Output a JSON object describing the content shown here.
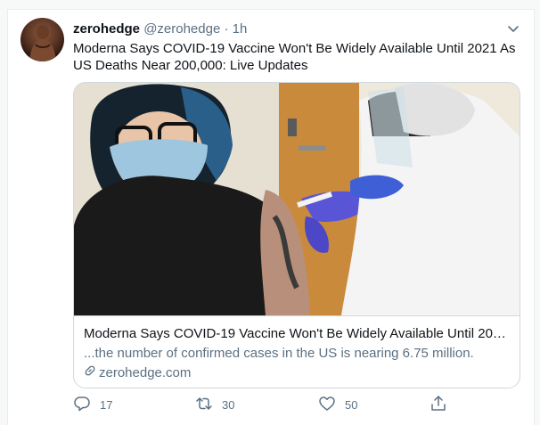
{
  "tweet": {
    "author_name": "zerohedge",
    "author_handle": "@zerohedge",
    "separator": "·",
    "timestamp": "1h",
    "text": "Moderna Says COVID-19 Vaccine Won't Be Widely Available Until 2021 As US Deaths Near 200,000: Live Updates"
  },
  "card": {
    "title": "Moderna Says COVID-19 Vaccine Won't Be Widely Available Until 2021 ...",
    "description": "...the number of confirmed cases in the US is nearing 6.75 million.",
    "domain": "zerohedge.com",
    "domain_icon": "link-icon"
  },
  "actions": {
    "reply_count": "17",
    "retweet_count": "30",
    "like_count": "50",
    "reply_icon": "reply-icon",
    "retweet_icon": "retweet-icon",
    "like_icon": "heart-icon",
    "share_icon": "share-icon"
  },
  "colors": {
    "text_primary": "#0f1419",
    "text_secondary": "#5b7083",
    "border": "#cfd9de",
    "background": "#f7f9f9"
  }
}
